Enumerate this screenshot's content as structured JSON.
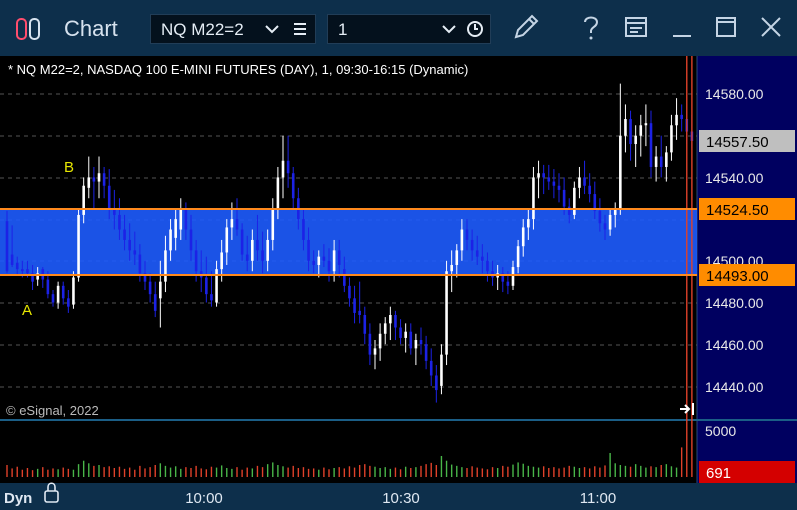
{
  "window": {
    "title": "Chart",
    "symbol": "NQ M22=2",
    "interval": "1",
    "icons": [
      "chart-app-icon",
      "chevron-down-icon",
      "menu-icon",
      "chevron-down-icon",
      "clock-icon",
      "pencil-icon",
      "help-icon",
      "layout-icon",
      "minimize-icon",
      "maximize-icon",
      "close-icon"
    ]
  },
  "chart": {
    "description": "* NQ M22=2, NASDAQ 100 E-MINI FUTURES (DAY), 1, 09:30-16:15 (Dynamic)",
    "copyright": "© eSignal, 2022",
    "price_axis_labels": [
      "14580.00",
      "14540.00",
      "14500.00",
      "14480.00",
      "14460.00",
      "14440.00"
    ],
    "last_price": "14557.50",
    "upper_level": "14524.50",
    "lower_level": "14493.00",
    "label_a": "A",
    "label_b": "B",
    "volume_axis_label": "5000",
    "last_volume": "691",
    "time_labels": [
      "10:00",
      "10:30",
      "11:00"
    ],
    "dyn_label": "Dyn",
    "colors": {
      "up_candle": "#ffffff",
      "down_candle": "#1c22e6",
      "band_fill": "#1e5cff",
      "level_line": "#ff8a1e",
      "last_price_bg": "#bfbfbf",
      "level_label_bg": "#ff8c00",
      "volume_label_bg": "#d40000",
      "axis_bg": "#000060",
      "annotation": "#e6e600"
    }
  },
  "chart_data": {
    "type": "candlestick",
    "title": "* NQ M22=2, NASDAQ 100 E-MINI FUTURES (DAY), 1, 09:30-16:15 (Dynamic)",
    "y_ticks": [
      14440,
      14460,
      14480,
      14500,
      14540,
      14580
    ],
    "ylim": [
      14425,
      14597
    ],
    "x_ticks": [
      "10:00",
      "10:30",
      "11:00"
    ],
    "last_price": 14557.5,
    "levels": [
      14524.5,
      14493.0
    ],
    "annotations": [
      {
        "text": "A",
        "price": 14480
      },
      {
        "text": "B",
        "price": 14545
      }
    ],
    "ohlc": [
      [
        14519,
        14524,
        14494,
        14495
      ],
      [
        14503,
        14517,
        14497,
        14498
      ],
      [
        14499,
        14502,
        14493,
        14496
      ],
      [
        14496,
        14500,
        14492,
        14495
      ],
      [
        14496,
        14500,
        14492,
        14494
      ],
      [
        14494,
        14498,
        14486,
        14490
      ],
      [
        14491,
        14497,
        14488,
        14494
      ],
      [
        14496,
        14497,
        14487,
        14491
      ],
      [
        14491,
        14495,
        14482,
        14484
      ],
      [
        14484,
        14486,
        14478,
        14480
      ],
      [
        14480,
        14490,
        14477,
        14488
      ],
      [
        14488,
        14490,
        14479,
        14482
      ],
      [
        14482,
        14486,
        14475,
        14478
      ],
      [
        14479,
        14495,
        14477,
        14492
      ],
      [
        14492,
        14525,
        14490,
        14522
      ],
      [
        14522,
        14540,
        14518,
        14536
      ],
      [
        14535,
        14550,
        14530,
        14540
      ],
      [
        14540,
        14545,
        14525,
        14538
      ],
      [
        14538,
        14550,
        14530,
        14542
      ],
      [
        14542,
        14545,
        14530,
        14536
      ],
      [
        14536,
        14544,
        14520,
        14525
      ],
      [
        14525,
        14534,
        14515,
        14522
      ],
      [
        14522,
        14530,
        14510,
        14515
      ],
      [
        14515,
        14522,
        14505,
        14510
      ],
      [
        14510,
        14518,
        14500,
        14505
      ],
      [
        14505,
        14514,
        14498,
        14503
      ],
      [
        14503,
        14508,
        14490,
        14494
      ],
      [
        14494,
        14500,
        14486,
        14490
      ],
      [
        14490,
        14494,
        14480,
        14484
      ],
      [
        14484,
        14490,
        14473,
        14476
      ],
      [
        14482,
        14500,
        14468,
        14490
      ],
      [
        14490,
        14512,
        14485,
        14505
      ],
      [
        14505,
        14520,
        14500,
        14515
      ],
      [
        14511,
        14525,
        14505,
        14520
      ],
      [
        14515,
        14530,
        14510,
        14525
      ],
      [
        14525,
        14528,
        14510,
        14515
      ],
      [
        14515,
        14522,
        14500,
        14505
      ],
      [
        14505,
        14510,
        14490,
        14495
      ],
      [
        14495,
        14505,
        14485,
        14492
      ],
      [
        14492,
        14502,
        14480,
        14484
      ],
      [
        14484,
        14495,
        14478,
        14481
      ],
      [
        14480,
        14500,
        14478,
        14496
      ],
      [
        14496,
        14510,
        14490,
        14504
      ],
      [
        14504,
        14520,
        14498,
        14516
      ],
      [
        14516,
        14528,
        14510,
        14520
      ],
      [
        14520,
        14530,
        14512,
        14515
      ],
      [
        14515,
        14518,
        14500,
        14503
      ],
      [
        14503,
        14512,
        14495,
        14500
      ],
      [
        14500,
        14515,
        14495,
        14510
      ],
      [
        14510,
        14522,
        14500,
        14505
      ],
      [
        14505,
        14514,
        14494,
        14500
      ],
      [
        14500,
        14515,
        14495,
        14510
      ],
      [
        14510,
        14530,
        14505,
        14525
      ],
      [
        14525,
        14545,
        14520,
        14540
      ],
      [
        14540,
        14560,
        14530,
        14548
      ],
      [
        14548,
        14560,
        14535,
        14542
      ],
      [
        14542,
        14545,
        14525,
        14530
      ],
      [
        14530,
        14535,
        14515,
        14520
      ],
      [
        14520,
        14525,
        14505,
        14510
      ],
      [
        14510,
        14516,
        14495,
        14500
      ],
      [
        14500,
        14505,
        14494,
        14498
      ],
      [
        14498,
        14505,
        14492,
        14502
      ],
      [
        14502,
        14508,
        14497,
        14500
      ],
      [
        14500,
        14506,
        14490,
        14495
      ],
      [
        14495,
        14510,
        14490,
        14505
      ],
      [
        14505,
        14510,
        14492,
        14498
      ],
      [
        14496,
        14502,
        14485,
        14488
      ],
      [
        14488,
        14492,
        14478,
        14482
      ],
      [
        14482,
        14488,
        14470,
        14475
      ],
      [
        14476,
        14490,
        14470,
        14474
      ],
      [
        14474,
        14478,
        14460,
        14465
      ],
      [
        14465,
        14470,
        14450,
        14455
      ],
      [
        14455,
        14462,
        14448,
        14458
      ],
      [
        14458,
        14470,
        14452,
        14465
      ],
      [
        14465,
        14473,
        14460,
        14470
      ],
      [
        14470,
        14478,
        14462,
        14474
      ],
      [
        14474,
        14476,
        14462,
        14468
      ],
      [
        14468,
        14472,
        14460,
        14463
      ],
      [
        14463,
        14470,
        14456,
        14466
      ],
      [
        14466,
        14470,
        14455,
        14458
      ],
      [
        14458,
        14465,
        14450,
        14462
      ],
      [
        14462,
        14468,
        14455,
        14460
      ],
      [
        14460,
        14464,
        14448,
        14452
      ],
      [
        14452,
        14458,
        14440,
        14445
      ],
      [
        14445,
        14450,
        14432,
        14438
      ],
      [
        14440,
        14460,
        14436,
        14455
      ],
      [
        14455,
        14500,
        14450,
        14495
      ],
      [
        14495,
        14505,
        14485,
        14498
      ],
      [
        14498,
        14508,
        14492,
        14505
      ],
      [
        14505,
        14520,
        14500,
        14515
      ],
      [
        14515,
        14520,
        14505,
        14510
      ],
      [
        14510,
        14515,
        14500,
        14505
      ],
      [
        14505,
        14512,
        14498,
        14502
      ],
      [
        14502,
        14508,
        14494,
        14500
      ],
      [
        14500,
        14504,
        14490,
        14495
      ],
      [
        14495,
        14500,
        14488,
        14492
      ],
      [
        14492,
        14498,
        14486,
        14494
      ],
      [
        14494,
        14497,
        14485,
        14490
      ],
      [
        14490,
        14495,
        14484,
        14488
      ],
      [
        14488,
        14500,
        14486,
        14497
      ],
      [
        14497,
        14510,
        14494,
        14507
      ],
      [
        14507,
        14520,
        14502,
        14516
      ],
      [
        14516,
        14525,
        14510,
        14520
      ],
      [
        14520,
        14545,
        14515,
        14540
      ],
      [
        14540,
        14548,
        14530,
        14542
      ],
      [
        14542,
        14546,
        14532,
        14540
      ],
      [
        14540,
        14546,
        14534,
        14538
      ],
      [
        14538,
        14544,
        14530,
        14536
      ],
      [
        14536,
        14542,
        14528,
        14534
      ],
      [
        14534,
        14540,
        14522,
        14526
      ],
      [
        14526,
        14530,
        14518,
        14522
      ],
      [
        14522,
        14538,
        14520,
        14535
      ],
      [
        14535,
        14545,
        14530,
        14540
      ],
      [
        14540,
        14548,
        14532,
        14536
      ],
      [
        14536,
        14542,
        14528,
        14532
      ],
      [
        14532,
        14538,
        14520,
        14524
      ],
      [
        14524,
        14530,
        14514,
        14518
      ],
      [
        14518,
        14522,
        14510,
        14515
      ],
      [
        14515,
        14525,
        14512,
        14522
      ],
      [
        14522,
        14528,
        14516,
        14525
      ],
      [
        14525,
        14585,
        14522,
        14560
      ],
      [
        14560,
        14575,
        14552,
        14568
      ],
      [
        14568,
        14572,
        14548,
        14556
      ],
      [
        14556,
        14565,
        14545,
        14560
      ],
      [
        14560,
        14570,
        14550,
        14565
      ],
      [
        14565,
        14575,
        14555,
        14566
      ],
      [
        14566,
        14572,
        14540,
        14545
      ],
      [
        14545,
        14555,
        14538,
        14550
      ],
      [
        14550,
        14560,
        14540,
        14545
      ],
      [
        14545,
        14555,
        14538,
        14552
      ],
      [
        14552,
        14570,
        14548,
        14565
      ],
      [
        14565,
        14578,
        14558,
        14570
      ],
      [
        14570,
        14575,
        14562,
        14568
      ],
      [
        14568,
        14572,
        14556,
        14562
      ],
      [
        14562,
        14570,
        14554,
        14557.5
      ]
    ],
    "volume": [
      280,
      200,
      240,
      170,
      210,
      160,
      190,
      230,
      170,
      200,
      180,
      220,
      190,
      170,
      300,
      380,
      320,
      260,
      280,
      230,
      250,
      210,
      240,
      190,
      220,
      170,
      260,
      200,
      230,
      280,
      320,
      260,
      220,
      250,
      190,
      230,
      210,
      260,
      200,
      180,
      240,
      220,
      270,
      210,
      190,
      230,
      170,
      220,
      200,
      260,
      230,
      300,
      340,
      280,
      250,
      220,
      260,
      210,
      230,
      190,
      200,
      170,
      220,
      180,
      210,
      230,
      200,
      250,
      220,
      280,
      300,
      260,
      240,
      210,
      230,
      190,
      220,
      180,
      240,
      210,
      230,
      260,
      300,
      330,
      280,
      490,
      380,
      290,
      260,
      230,
      210,
      250,
      220,
      200,
      180,
      230,
      210,
      260,
      240,
      290,
      340,
      310,
      260,
      240,
      220,
      250,
      210,
      230,
      200,
      220,
      260,
      240,
      210,
      230,
      200,
      250,
      220,
      270,
      560,
      320,
      280,
      260,
      240,
      300,
      260,
      220,
      250,
      230,
      280,
      300,
      250,
      220,
      691
    ]
  }
}
